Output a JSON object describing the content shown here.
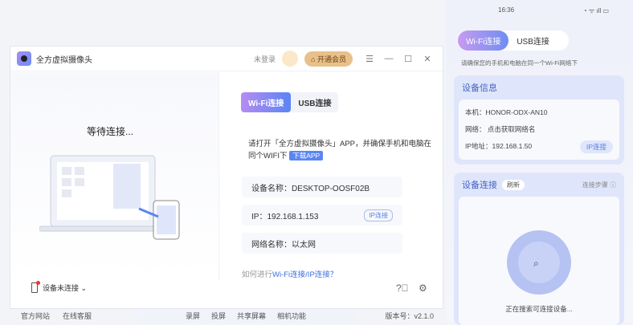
{
  "app": {
    "title": "全方虚拟摄像头",
    "login": "未登录",
    "vip": "开通会员",
    "menu": "☰",
    "min": "—",
    "max": "☐",
    "close": "✕"
  },
  "left": {
    "waiting": "等待连接..."
  },
  "tabs": [
    "Wi-Fi连接",
    "USB连接"
  ],
  "hint": {
    "text": "请打开「全方虚拟摄像头」APP，并确保手机和电脑在同个WIFI下",
    "download": "下载APP"
  },
  "info": {
    "device": "设备名称：DESKTOP-OOSF02B",
    "ip": "IP：192.168.1.153",
    "ip_button": "IP连接",
    "network": "网络名称：以太网"
  },
  "howto": {
    "prefix": "如何进行",
    "link": "Wi-Fi连接/IP连接？"
  },
  "device_status": "设备未连接 ⌄",
  "bottom": {
    "left1": "官方网站",
    "left2": "在线客服",
    "mid": [
      "录屏",
      "投屏",
      "共享屏幕",
      "相机功能"
    ],
    "version": "版本号：v2.1.0"
  },
  "phone": {
    "time": "16:36",
    "status": "◔ ᯤ ıll ▭",
    "tabs": [
      "Wi-Fi连接",
      "USB连接"
    ],
    "tip": "请确保您的手机和电脑在同一个Wi-Fi网络下",
    "info_title": "设备信息",
    "model": "本机：HONOR-ODX-AN10",
    "network": "网络：  点击获取网络名",
    "ip": "IP地址：192.168.1.50",
    "ip_button": "IP连接",
    "connect_title": "设备连接",
    "refresh": "刷新",
    "steps": "连接步骤 ⓘ",
    "searching": "正在搜索可连接设备..."
  }
}
